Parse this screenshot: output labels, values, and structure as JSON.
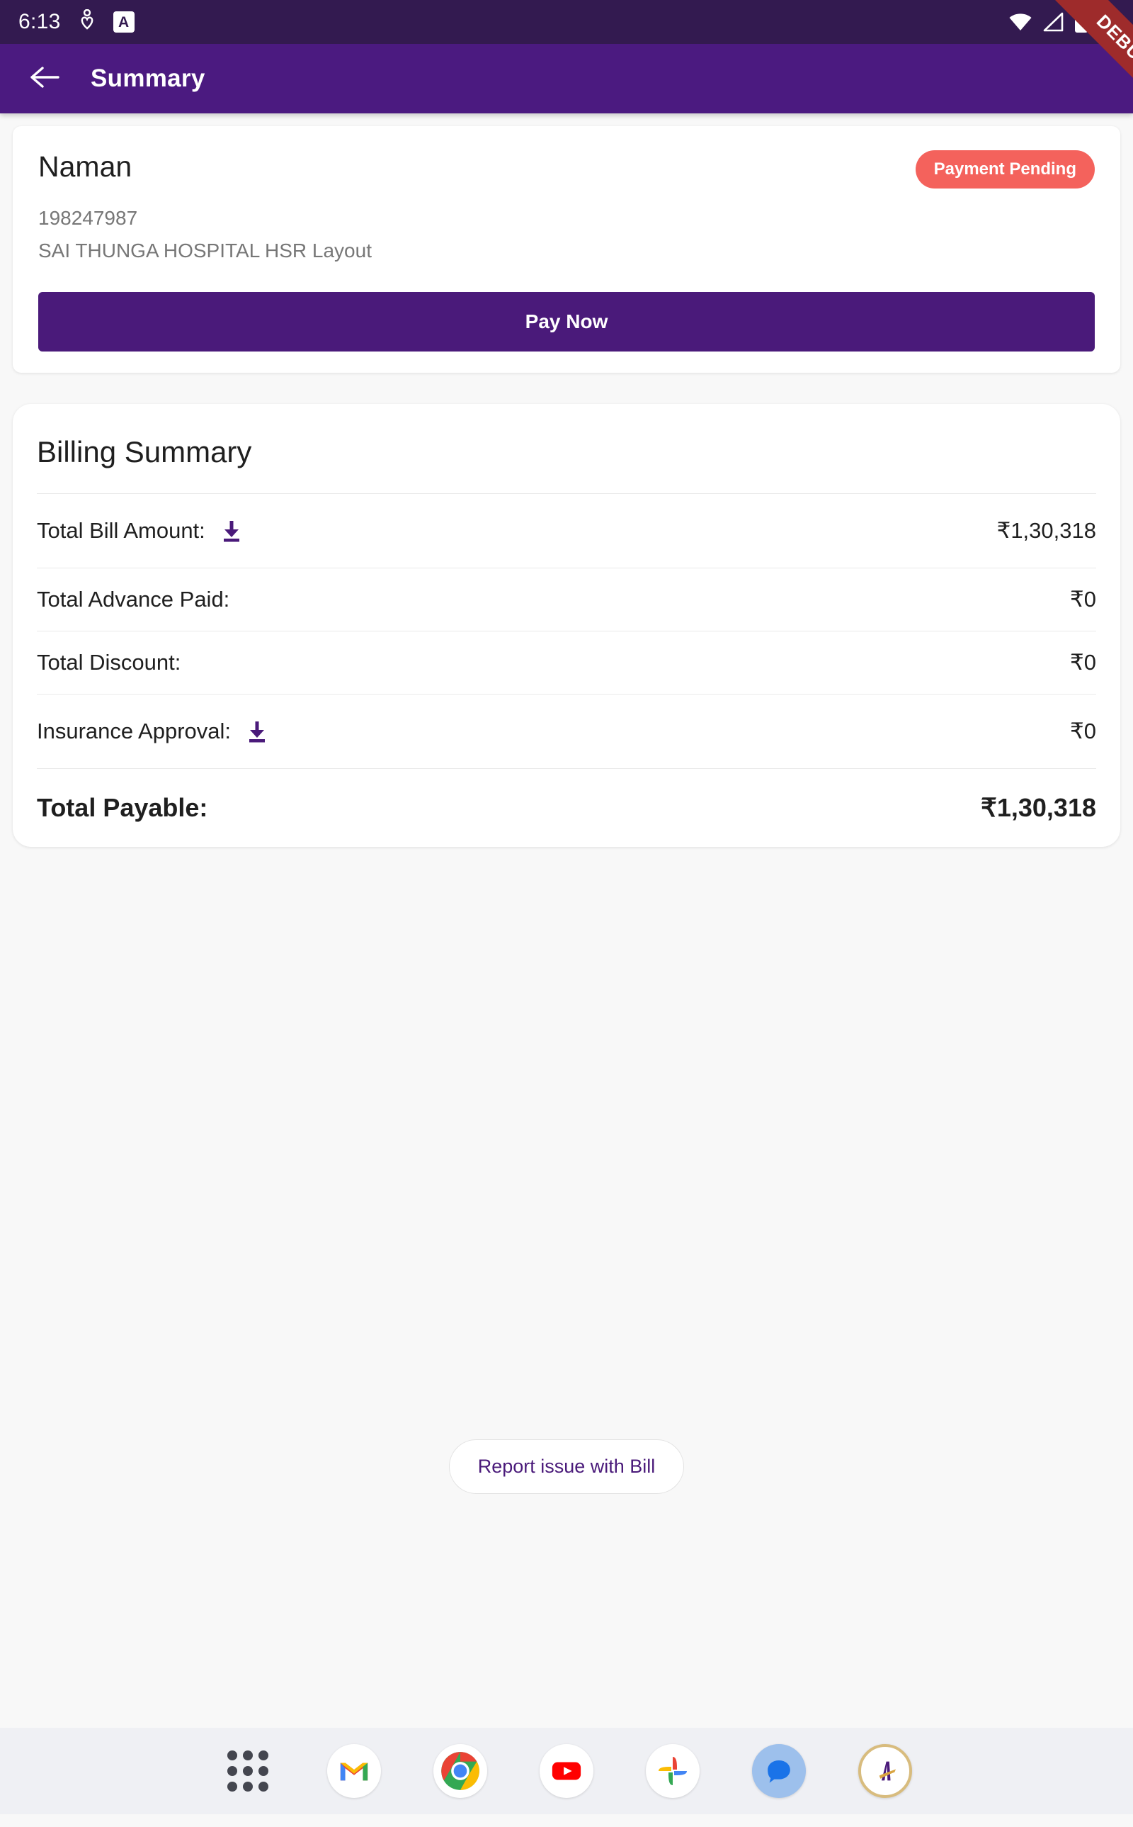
{
  "status_bar": {
    "time": "6:13",
    "icons": [
      "location-heart-icon",
      "app-badge-a",
      "wifi-icon",
      "signal-icon",
      "battery-icon"
    ],
    "app_badge_letter": "A",
    "background_color": "#331A50"
  },
  "debug_ribbon": {
    "label": "DEBUG",
    "color": "#9E2B2B"
  },
  "app_bar": {
    "back_icon": "arrow-left-icon",
    "title": "Summary",
    "background_color": "#4B1A80"
  },
  "patient_card": {
    "name": "Naman",
    "status_badge": "Payment Pending",
    "status_badge_color": "#F4625C",
    "patient_id": "198247987",
    "hospital": "SAI THUNGA HOSPITAL HSR Layout",
    "pay_button_label": "Pay Now",
    "pay_button_color": "#4A1A7A"
  },
  "billing_summary": {
    "title": "Billing Summary",
    "accent_color": "#4A1A7A",
    "rows": [
      {
        "label": "Total Bill Amount:",
        "value": "₹1,30,318",
        "has_download": true
      },
      {
        "label": "Total Advance Paid:",
        "value": "₹0",
        "has_download": false
      },
      {
        "label": "Total Discount:",
        "value": "₹0",
        "has_download": false
      },
      {
        "label": "Insurance Approval:",
        "value": "₹0",
        "has_download": true
      }
    ],
    "total": {
      "label": "Total Payable:",
      "value": "₹1,30,318"
    }
  },
  "report_button": {
    "label": "Report issue with Bill",
    "text_color": "#4A1A7A"
  },
  "dock": {
    "background_color": "#EFF0F4",
    "items": [
      {
        "name": "app-drawer-icon",
        "label": "App drawer"
      },
      {
        "name": "gmail-icon",
        "label": "Gmail"
      },
      {
        "name": "chrome-icon",
        "label": "Chrome"
      },
      {
        "name": "youtube-icon",
        "label": "YouTube"
      },
      {
        "name": "google-photos-icon",
        "label": "Photos"
      },
      {
        "name": "google-messages-icon",
        "label": "Messages"
      },
      {
        "name": "app-icon-a",
        "label": "A"
      }
    ]
  }
}
